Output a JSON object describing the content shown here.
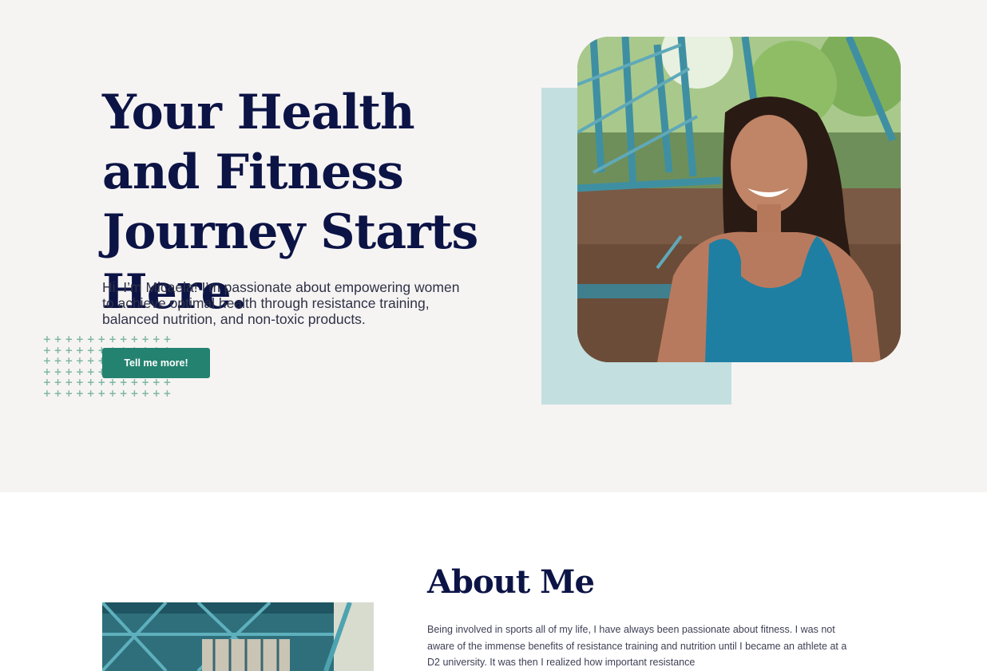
{
  "hero": {
    "title": "Your Health and Fitness Journey Starts Here.",
    "intro": "Hi, I’m Micaela! I’m passionate about empowering women to achieve optimal health through resistance training, balanced nutrition, and non-toxic products.",
    "cta_label": "Tell me more!",
    "dot_glyph": "+"
  },
  "about": {
    "title": "About Me",
    "body": "Being involved in sports all of my life, I have always been passionate about fitness. I was not aware of the immense benefits of resistance training and nutrition until I became an athlete at a D2 university. It was then I realized how important resistance"
  },
  "colors": {
    "hero_bg": "#f6f4f3",
    "heading": "#0c1446",
    "cta_bg": "#248270",
    "accent_block": "#c4dfe0",
    "dot_pattern": "#7fb6a3"
  }
}
